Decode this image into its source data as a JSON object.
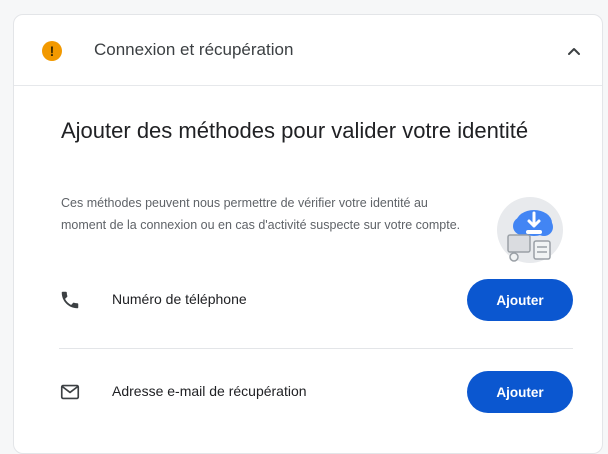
{
  "header": {
    "warning_glyph": "!",
    "title": "Connexion et récupération"
  },
  "section": {
    "title": "Ajouter des méthodes pour valider votre identité",
    "description": "Ces méthodes peuvent nous permettre de vérifier votre identité au moment de la connexion ou en cas d'activité suspecte sur votre compte."
  },
  "methods": [
    {
      "icon": "phone-icon",
      "label": "Numéro de téléphone",
      "button": "Ajouter"
    },
    {
      "icon": "mail-icon",
      "label": "Adresse e-mail de récupération",
      "button": "Ajouter"
    }
  ],
  "colors": {
    "accent": "#0b57d0",
    "warning": "#f29900"
  }
}
